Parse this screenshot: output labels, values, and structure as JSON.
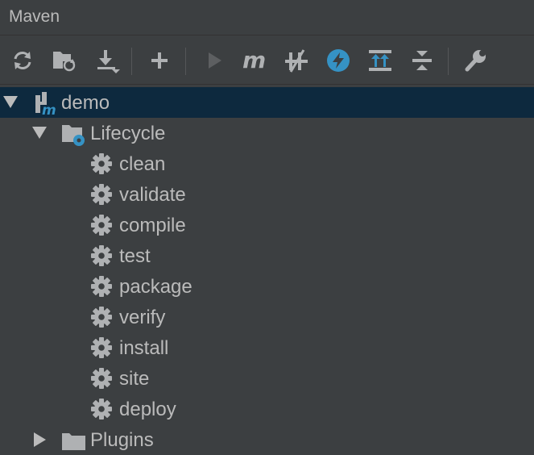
{
  "panel": {
    "title": "Maven"
  },
  "toolbar": {
    "buttons": [
      {
        "name": "reimport-icon"
      },
      {
        "name": "generate-sources-icon"
      },
      {
        "name": "download-icon"
      },
      {
        "name": "add-icon"
      },
      {
        "name": "run-icon"
      },
      {
        "name": "execute-goal-icon"
      },
      {
        "name": "toggle-offline-icon"
      },
      {
        "name": "skip-tests-icon"
      },
      {
        "name": "show-dependencies-icon"
      },
      {
        "name": "collapse-all-icon"
      },
      {
        "name": "settings-icon"
      }
    ]
  },
  "tree": {
    "project": "demo",
    "lifecycle": "Lifecycle",
    "goals": [
      "clean",
      "validate",
      "compile",
      "test",
      "package",
      "verify",
      "install",
      "site",
      "deploy"
    ],
    "plugins": "Plugins"
  },
  "colors": {
    "background": "#3c3f41",
    "selection": "#0d293e",
    "text": "#bbbbbb",
    "icon": "#afb1b3",
    "accent": "#3592c4"
  }
}
